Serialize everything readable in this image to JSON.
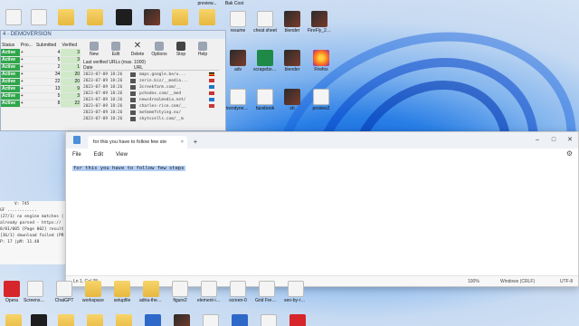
{
  "desktop": {
    "top_labels": [
      "",
      "",
      "",
      "",
      "",
      "",
      "",
      "",
      "",
      "",
      "preview...",
      "Bak Cost",
      "",
      "",
      "",
      ""
    ],
    "right_icons": [
      {
        "label": "resume",
        "icon": "doc-icon"
      },
      {
        "label": "cheat sheet",
        "icon": "doc-icon"
      },
      {
        "label": "blender",
        "icon": "image-icon"
      },
      {
        "label": "FireFly_202",
        "icon": "image-icon"
      },
      {
        "label": "adv",
        "icon": "image-icon"
      },
      {
        "label": "scrapebox-ap...",
        "icon": "doc-icon"
      },
      {
        "label": "blender",
        "icon": "image-icon"
      },
      {
        "label": "Firefox",
        "icon": "firefox-icon"
      },
      {
        "label": "trendynewsbl...",
        "icon": "doc-icon"
      },
      {
        "label": "facebook",
        "icon": "doc-icon"
      },
      {
        "label": "sh",
        "icon": "image-icon"
      },
      {
        "label": "proxies2",
        "icon": "doc-icon"
      }
    ],
    "bottom_icons": [
      {
        "label": "Opera",
        "icon": "opera-icon"
      },
      {
        "label": "Screenshot 2023-07-08...",
        "icon": "image-icon"
      },
      {
        "label": "ChatGPT",
        "icon": "doc-icon"
      },
      {
        "label": "workspace",
        "icon": "folder-icon"
      },
      {
        "label": "setupfile",
        "icon": "folder-icon"
      },
      {
        "label": "adria-theme2",
        "icon": "folder-icon"
      },
      {
        "label": "figure2",
        "icon": "image-icon"
      },
      {
        "label": "element-image",
        "icon": "image-icon"
      },
      {
        "label": "screen-0",
        "icon": "image-icon"
      },
      {
        "label": "Grid Free ECommerce...",
        "icon": "doc-icon"
      },
      {
        "label": "seo-by-ram...",
        "icon": "doc-icon"
      }
    ]
  },
  "app": {
    "title": "4 - DEMOVERSION",
    "columns": [
      "Status",
      "Prio...",
      "Submitted",
      "Verified"
    ],
    "rows": [
      {
        "status": "Active",
        "prio": "+",
        "submitted": "4",
        "verified": "3"
      },
      {
        "status": "Active",
        "prio": "+",
        "submitted": "5",
        "verified": "3"
      },
      {
        "status": "Active",
        "prio": "+",
        "submitted": "2",
        "verified": "1"
      },
      {
        "status": "Active",
        "prio": "+",
        "submitted": "34",
        "verified": "20"
      },
      {
        "status": "Active",
        "prio": "+",
        "submitted": "22",
        "verified": "20"
      },
      {
        "status": "Active",
        "prio": "+",
        "submitted": "13",
        "verified": "9"
      },
      {
        "status": "Active",
        "prio": "+",
        "submitted": "5",
        "verified": "3"
      },
      {
        "status": "Active",
        "prio": "+",
        "submitted": "8",
        "verified": "22"
      }
    ],
    "toolbar": [
      {
        "label": "New",
        "icon": "new-icon"
      },
      {
        "label": "Edit",
        "icon": "edit-icon"
      },
      {
        "label": "Delete",
        "icon": "delete-icon"
      },
      {
        "label": "Options",
        "icon": "options-icon"
      },
      {
        "label": "Stop",
        "icon": "stop-icon"
      },
      {
        "label": "Help",
        "icon": "help-icon"
      }
    ],
    "verified_title": "Last verified URLs (max. 1000)",
    "url_header": {
      "date": "Date",
      "url": "URL"
    },
    "urls": [
      {
        "date": "2023-07-09 18:26",
        "url": "maps.google.be/u..."
      },
      {
        "date": "2023-07-09 18:26",
        "url": "zerin.biz/__media..."
      },
      {
        "date": "2023-07-09 18:26",
        "url": "3creekfarm.com/__"
      },
      {
        "date": "2023-07-09 18:26",
        "url": "pchodex.com/__med"
      },
      {
        "date": "2023-07-09 18:26",
        "url": "news4realmedia.net/"
      },
      {
        "date": "2023-07-09 18:26",
        "url": "charles-rice.com/__"
      },
      {
        "date": "2023-07-09 18:26",
        "url": "motmemfstying.eu/"
      },
      {
        "date": "2023-07-09 18:26",
        "url": "skytscells.com/__m"
      }
    ]
  },
  "console": {
    "vline": "V: 745",
    "lines": [
      "GF  ............",
      "(27/1) no engine matches (",
      "already parsed - https://",
      "8/01/005 [Page 002] result",
      "[36/1] download failed (PR",
      "P: 17    |pM: 11.48"
    ]
  },
  "notepad": {
    "tab_title": "for this you have to follow few ste",
    "menu": [
      "File",
      "Edit",
      "View"
    ],
    "content": "for this you have to follow few steps",
    "status": {
      "position": "Ln 1, Col 38",
      "zoom": "100%",
      "line_ending": "Windows (CRLF)",
      "encoding": "UTF-8"
    }
  }
}
